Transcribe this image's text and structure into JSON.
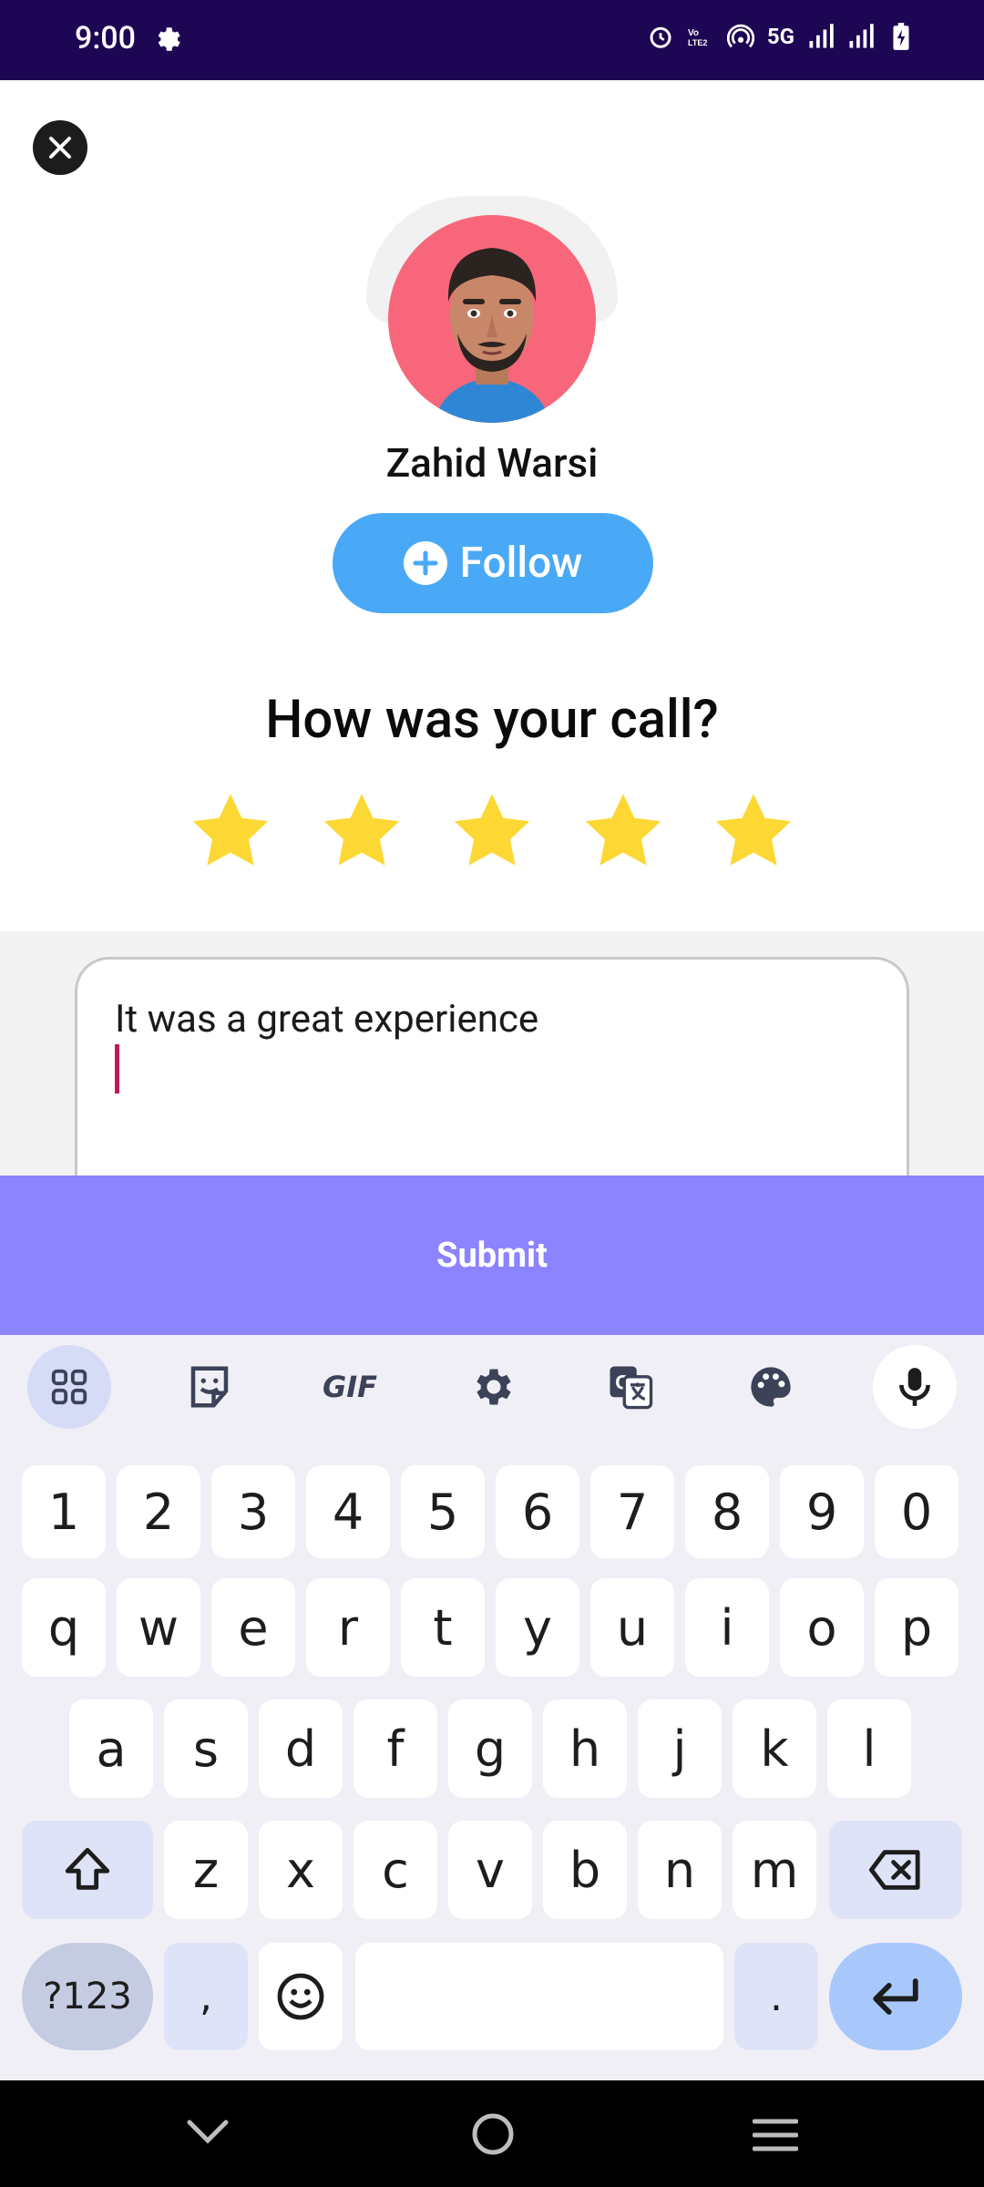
{
  "status_bar": {
    "time": "9:00",
    "icons": [
      "settings-icon",
      "alarm-icon",
      "volte-icon",
      "hotspot-icon",
      "5g-icon",
      "signal-icon",
      "signal-icon",
      "battery-charging-icon"
    ],
    "network_label": "5G"
  },
  "profile": {
    "name": "Zahid Warsi",
    "follow_label": "Follow"
  },
  "rating": {
    "question": "How was your call?",
    "stars_selected": 5,
    "stars_total": 5,
    "star_color": "#fdd835"
  },
  "feedback": {
    "text": "It was a great experience"
  },
  "submit_label": "Submit",
  "keyboard": {
    "toolbar": [
      "apps-grid-icon",
      "sticker-icon",
      "gif-icon",
      "settings-icon",
      "translate-icon",
      "palette-icon",
      "mic-icon"
    ],
    "toolbar_gif_label": "GIF",
    "row_numbers": [
      "1",
      "2",
      "3",
      "4",
      "5",
      "6",
      "7",
      "8",
      "9",
      "0"
    ],
    "row1": [
      "q",
      "w",
      "e",
      "r",
      "t",
      "y",
      "u",
      "i",
      "o",
      "p"
    ],
    "row2": [
      "a",
      "s",
      "d",
      "f",
      "g",
      "h",
      "j",
      "k",
      "l"
    ],
    "row3": [
      "z",
      "x",
      "c",
      "v",
      "b",
      "n",
      "m"
    ],
    "sym_label": "?123",
    "comma": ",",
    "period": "."
  },
  "colors": {
    "status_bar": "#1d0653",
    "follow": "#4aa9f6",
    "submit": "#8c83ff",
    "avatar_bg": "#f7667a"
  }
}
